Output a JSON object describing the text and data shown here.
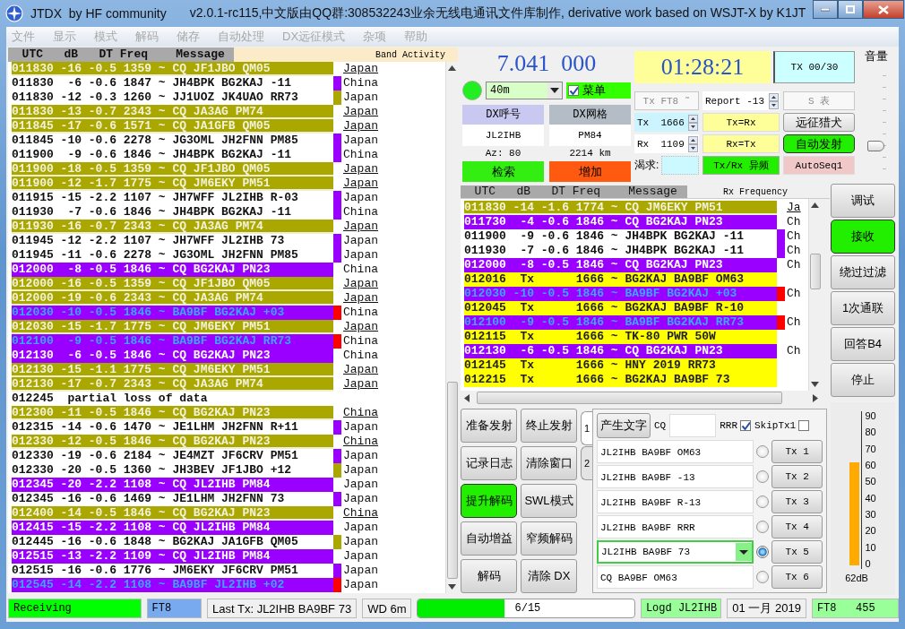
{
  "window": {
    "title": "JTDX  by HF community",
    "subtitle": "v2.0.1-rc115,中文版由QQ群:308532243业余无线电通讯文件库制作, derivative work based on WSJT-X by K1JT"
  },
  "menu": [
    "文件",
    "显示",
    "模式",
    "解码",
    "储存",
    "自动处理",
    "DX远征模式",
    "杂项",
    "帮助"
  ],
  "band_activity": {
    "header": "  UTC   dB   DT Freq    Message",
    "title": "Band Activity",
    "rows": [
      {
        "kind": "cq",
        "message": "011830 -16 -0.5 1359 ~ CQ JF1JBO QM05",
        "country": "Japan"
      },
      {
        "kind": "plain",
        "message": "011830  -6 -0.6 1847 ~ JH4BPK BG2KAJ -11",
        "color": "#9900ff",
        "country": "China"
      },
      {
        "kind": "plain",
        "message": "011830 -12 -0.3 1260 ~ JJ1UOZ JK4UAO RR73",
        "color": "#aaa800",
        "country": "Japan"
      },
      {
        "kind": "cq",
        "message": "011830 -13 -0.7 2343 ~ CQ JA3AG PM74",
        "country": "Japan"
      },
      {
        "kind": "cq",
        "message": "011845 -17 -0.6 1571 ~ CQ JA1GFB QM05",
        "country": "Japan"
      },
      {
        "kind": "plain",
        "message": "011845 -10 -0.6 2278 ~ JG3OML JH2FNN PM85",
        "color": "#9900ff",
        "country": "Japan"
      },
      {
        "kind": "plain",
        "message": "011900  -9 -0.6 1846 ~ JH4BPK BG2KAJ -11",
        "color": "#9900ff",
        "country": "China"
      },
      {
        "kind": "cq",
        "message": "011900 -18 -0.5 1359 ~ CQ JF1JBO QM05",
        "country": "Japan"
      },
      {
        "kind": "cq",
        "message": "011900 -12 -1.7 1775 ~ CQ JM6EKY PM51",
        "country": "Japan"
      },
      {
        "kind": "plain",
        "message": "011915 -15 -2.2 1107 ~ JH7WFF JL2IHB R-03",
        "color": "#9900ff",
        "country": "Japan"
      },
      {
        "kind": "plain",
        "message": "011930  -7 -0.6 1846 ~ JH4BPK BG2KAJ -11",
        "color": "#9900ff",
        "country": "China"
      },
      {
        "kind": "cq",
        "message": "011930 -16 -0.7 2343 ~ CQ JA3AG PM74",
        "country": "Japan"
      },
      {
        "kind": "plain",
        "message": "011945 -12 -2.2 1107 ~ JH7WFF JL2IHB 73",
        "color": "#9900ff",
        "country": "Japan"
      },
      {
        "kind": "plain",
        "message": "011945 -11 -0.6 2278 ~ JG3OML JH2FNN PM85",
        "color": "#9900ff",
        "country": "Japan"
      },
      {
        "kind": "mine",
        "message": "012000  -8 -0.5 1846 ~ CQ BG2KAJ PN23",
        "country": "China"
      },
      {
        "kind": "cq",
        "message": "012000 -16 -0.5 1359 ~ CQ JF1JBO QM05",
        "country": "Japan"
      },
      {
        "kind": "cq",
        "message": "012000 -19 -0.6 2343 ~ CQ JA3AG PM74",
        "country": "Japan"
      },
      {
        "kind": "tome",
        "message": "012030 -10 -0.5 1846 ~ BA9BF BG2KAJ +03",
        "color": "#ff0000",
        "country": "China"
      },
      {
        "kind": "cq",
        "message": "012030 -15 -1.7 1775 ~ CQ JM6EKY PM51",
        "country": "Japan"
      },
      {
        "kind": "tome",
        "message": "012100  -9 -0.5 1846 ~ BA9BF BG2KAJ RR73",
        "color": "#ff0000",
        "country": "China"
      },
      {
        "kind": "mine",
        "message": "012130  -6 -0.5 1846 ~ CQ BG2KAJ PN23",
        "country": "China"
      },
      {
        "kind": "cq",
        "message": "012130 -15 -1.1 1775 ~ CQ JM6EKY PM51",
        "country": "Japan"
      },
      {
        "kind": "cq",
        "message": "012130 -17 -0.7 2343 ~ CQ JA3AG PM74",
        "country": "Japan"
      },
      {
        "kind": "note",
        "message": "012245  partial loss of data"
      },
      {
        "kind": "cq",
        "message": "012300 -11 -0.5 1846 ~ CQ BG2KAJ PN23",
        "country": "China"
      },
      {
        "kind": "plain",
        "message": "012315 -14 -0.6 1470 ~ JE1LHM JH2FNN R+11",
        "color": "#9900ff",
        "country": "Japan"
      },
      {
        "kind": "cq",
        "message": "012330 -12 -0.5 1846 ~ CQ BG2KAJ PN23",
        "country": "China"
      },
      {
        "kind": "plain",
        "message": "012330 -19 -0.6 2184 ~ JE4MZT JF6CRV PM51",
        "color": "#9900ff",
        "country": "Japan"
      },
      {
        "kind": "plain",
        "message": "012330 -20 -0.5 1360 ~ JH3BEV JF1JBO +12",
        "color": "#aaa800",
        "country": "Japan"
      },
      {
        "kind": "mine",
        "message": "012345 -20 -2.2 1108 ~ CQ JL2IHB PM84",
        "country": "Japan"
      },
      {
        "kind": "plain",
        "message": "012345 -16 -0.6 1469 ~ JE1LHM JH2FNN 73",
        "color": "#9900ff",
        "country": "Japan"
      },
      {
        "kind": "cq",
        "message": "012400 -14 -0.5 1846 ~ CQ BG2KAJ PN23",
        "country": "China"
      },
      {
        "kind": "mine",
        "message": "012415 -15 -2.2 1108 ~ CQ JL2IHB PM84",
        "country": "Japan"
      },
      {
        "kind": "plain",
        "message": "012445 -16 -0.6 1848 ~ BG2KAJ JA1GFB QM05",
        "color": "#aaa800",
        "country": "Japan"
      },
      {
        "kind": "mine",
        "message": "012515 -13 -2.2 1109 ~ CQ JL2IHB PM84",
        "country": "Japan"
      },
      {
        "kind": "plain",
        "message": "012515 -16 -0.6 1776 ~ JM6EKY JF6CRV PM51",
        "color": "#9900ff",
        "country": "Japan"
      },
      {
        "kind": "tome",
        "message": "012545 -14 -2.2 1108 ~ BA9BF JL2IHB +02",
        "color": "#ff0000",
        "country": "Japan"
      }
    ]
  },
  "dial": {
    "frequency": "7.041  000",
    "band": "40m",
    "menu": {
      "label": "菜单",
      "checked": true
    }
  },
  "dx": {
    "call_label": "DX呼号",
    "grid_label": "DX网格",
    "call": "JL2IHB",
    "grid": "PM84",
    "azimuth": "Az: 80",
    "distance": "2214 km",
    "buttons": [
      {
        "label": "检索",
        "kind": "lookup"
      },
      {
        "label": "增加",
        "kind": "add"
      }
    ]
  },
  "clock": {
    "time": "01:28:21",
    "tx_counter": "TX 00/30"
  },
  "controls": {
    "mode_button": {
      "label": "Tx FT8 ˜",
      "disabled": true
    },
    "report": "Report -13",
    "s_meter_button": {
      "label": "S 表",
      "disabled": true
    },
    "tx_freq": {
      "label": "Tx",
      "value": "1666"
    },
    "rx_freq": {
      "label": "Rx",
      "value": "1109"
    },
    "tx_eq_rx": "Tx=Rx",
    "rx_eq_tx": "Rx=Tx",
    "hound_button": {
      "label": "远征猎犬",
      "on": false
    },
    "auto_tx_button": {
      "label": "自动发射",
      "on": true
    },
    "wanted_label": "渴求:",
    "split_button": {
      "label": "Tx/Rx 异频",
      "on": true
    },
    "autoseq_button": "AutoSeq1"
  },
  "volume": {
    "label": "音量",
    "level": 0.32
  },
  "rx_frequency": {
    "header": "  UTC   dB   DT Freq    Message",
    "title": "Rx Frequency",
    "rows": [
      {
        "kind": "cq",
        "message": "011830 -14 -1.6 1774 ~ CQ JM6EKY PM51",
        "country": "Ja"
      },
      {
        "kind": "mine",
        "message": "011730  -4 -0.6 1846 ~ CQ BG2KAJ PN23",
        "country": "Ch"
      },
      {
        "kind": "plain",
        "message": "011900  -9 -0.6 1846 ~ JH4BPK BG2KAJ -11",
        "color": "#9900ff",
        "country": "Ch"
      },
      {
        "kind": "plain",
        "message": "011930  -7 -0.6 1846 ~ JH4BPK BG2KAJ -11",
        "color": "#9900ff",
        "country": "Ch"
      },
      {
        "kind": "mine",
        "message": "012000  -8 -0.5 1846 ~ CQ BG2KAJ PN23",
        "country": "Ch"
      },
      {
        "kind": "tx",
        "message": "012016  Tx      1666 ~ BG2KAJ BA9BF OM63"
      },
      {
        "kind": "tome",
        "message": "012030 -10 -0.5 1846 ~ BA9BF BG2KAJ +03",
        "color": "#ff0000",
        "country": "Ch"
      },
      {
        "kind": "tx",
        "message": "012045  Tx      1666 ~ BG2KAJ BA9BF R-10"
      },
      {
        "kind": "tome",
        "message": "012100  -9 -0.5 1846 ~ BA9BF BG2KAJ RR73",
        "color": "#ff0000",
        "country": "Ch"
      },
      {
        "kind": "tx",
        "message": "012115  Tx      1666 ~ TK-80 PWR 50W"
      },
      {
        "kind": "mine",
        "message": "012130  -6 -0.5 1846 ~ CQ BG2KAJ PN23",
        "country": "Ch"
      },
      {
        "kind": "tx",
        "message": "012145  Tx      1666 ~ HNY 2019 RR73"
      },
      {
        "kind": "tx",
        "message": "012215  Tx      1666 ~ BG2KAJ BA9BF 73"
      }
    ]
  },
  "side_buttons": [
    {
      "label": "调试",
      "on": false
    },
    {
      "label": "接收",
      "on": true
    },
    {
      "label": "绕过过滤",
      "on": false
    },
    {
      "label": "1次通联",
      "on": false
    },
    {
      "label": "回答B4",
      "on": false
    },
    {
      "label": "停止",
      "on": false
    }
  ],
  "action_buttons": [
    {
      "label": "准备发射",
      "on": false
    },
    {
      "label": "终止发射",
      "on": false
    },
    {
      "label": "记录日志",
      "on": false
    },
    {
      "label": "清除窗口",
      "on": false
    },
    {
      "label": "提升解码",
      "on": true
    },
    {
      "label": "SWL模式",
      "on": false
    },
    {
      "label": "自动增益",
      "on": false
    },
    {
      "label": "窄频解码",
      "on": false
    },
    {
      "label": "解码",
      "on": false
    },
    {
      "label": "清除 DX",
      "on": false
    }
  ],
  "tx_panel": {
    "tabs": [
      {
        "label": "1",
        "selected": true
      },
      {
        "label": "2",
        "selected": false
      }
    ],
    "generate_button": "产生文字",
    "cq_label": "CQ",
    "rrr": {
      "label": "RRR",
      "checked": true
    },
    "skip_tx1": {
      "label": "SkipTx1",
      "checked": false
    },
    "messages": [
      {
        "kind": "field",
        "text": "JL2IHB BA9BF OM63",
        "button": "Tx 1",
        "selected": false
      },
      {
        "kind": "field",
        "text": "JL2IHB BA9BF -13",
        "button": "Tx 2",
        "selected": false
      },
      {
        "kind": "field",
        "text": "JL2IHB BA9BF R-13",
        "button": "Tx 3",
        "selected": false
      },
      {
        "kind": "field",
        "text": "JL2IHB BA9BF RRR",
        "button": "Tx 4",
        "selected": false
      },
      {
        "kind": "combo",
        "text": "JL2IHB BA9BF 73",
        "button": "Tx 5",
        "selected": true
      },
      {
        "kind": "field",
        "text": "CQ BA9BF OM63",
        "button": "Tx 6",
        "selected": false
      }
    ]
  },
  "meter": {
    "scale": [
      "90",
      "80",
      "70",
      "60",
      "50",
      "40",
      "30",
      "20",
      "10",
      "0"
    ],
    "level": 0.69,
    "reading": "62dB"
  },
  "status_bar": [
    {
      "kind": "state",
      "text": "Receiving"
    },
    {
      "kind": "mode",
      "text": "FT8"
    },
    {
      "kind": "plain",
      "text": "Last Tx: JL2IHB BA9BF 73"
    },
    {
      "kind": "plain",
      "text": "WD 6m"
    },
    {
      "kind": "progress",
      "text": "6/15",
      "level": 0.4
    },
    {
      "kind": "logged",
      "text": "Logd JL2IHB"
    },
    {
      "kind": "plain",
      "text": "01 一月 2019"
    },
    {
      "kind": "logged",
      "text": "FT8   455"
    }
  ]
}
